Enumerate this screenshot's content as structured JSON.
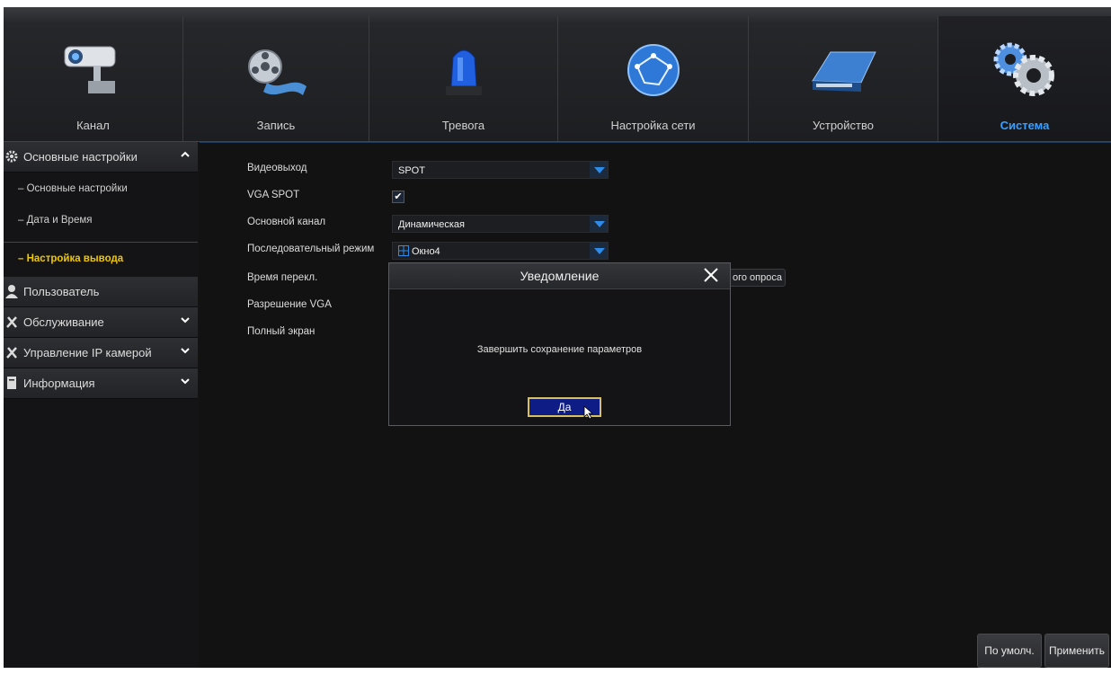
{
  "tabs": [
    {
      "label": "Канал",
      "icon": "camera-icon"
    },
    {
      "label": "Запись",
      "icon": "film-reel-icon"
    },
    {
      "label": "Тревога",
      "icon": "alarm-light-icon"
    },
    {
      "label": "Настройка сети",
      "icon": "network-globe-icon"
    },
    {
      "label": "Устройство",
      "icon": "hard-drive-icon"
    },
    {
      "label": "Система",
      "icon": "gears-icon",
      "active": true
    }
  ],
  "sidebar": {
    "section_main": "Основные настройки",
    "sub_items": [
      "Основные настройки",
      "Дата и Время",
      "Настройка вывода"
    ],
    "active_sub": "Настройка вывода",
    "sections": [
      "Пользователь",
      "Обслуживание",
      "Управление IP камерой",
      "Информация"
    ]
  },
  "form": {
    "labels": [
      "Видеовыход",
      "VGA SPOT",
      "Основной канал",
      "Последовательный режим",
      "Время перекл.",
      "Разрешение VGA",
      "Полный экран"
    ],
    "video_out": "SPOT",
    "vga_spot_checked": true,
    "check_mark": "✔",
    "main_channel": "Динамическая",
    "sequence_mode": "Окно4",
    "partial_button": "ого опроса"
  },
  "footer": {
    "default_label": "По умолч.",
    "apply_label": "Применить"
  },
  "dialog": {
    "title": "Уведомление",
    "message": "Завершить сохранение параметров",
    "ok_label": "Да"
  },
  "colors": {
    "accent": "#3aa0ff",
    "active_sub": "#f0c800",
    "dialog_button": "#0e1d86"
  }
}
